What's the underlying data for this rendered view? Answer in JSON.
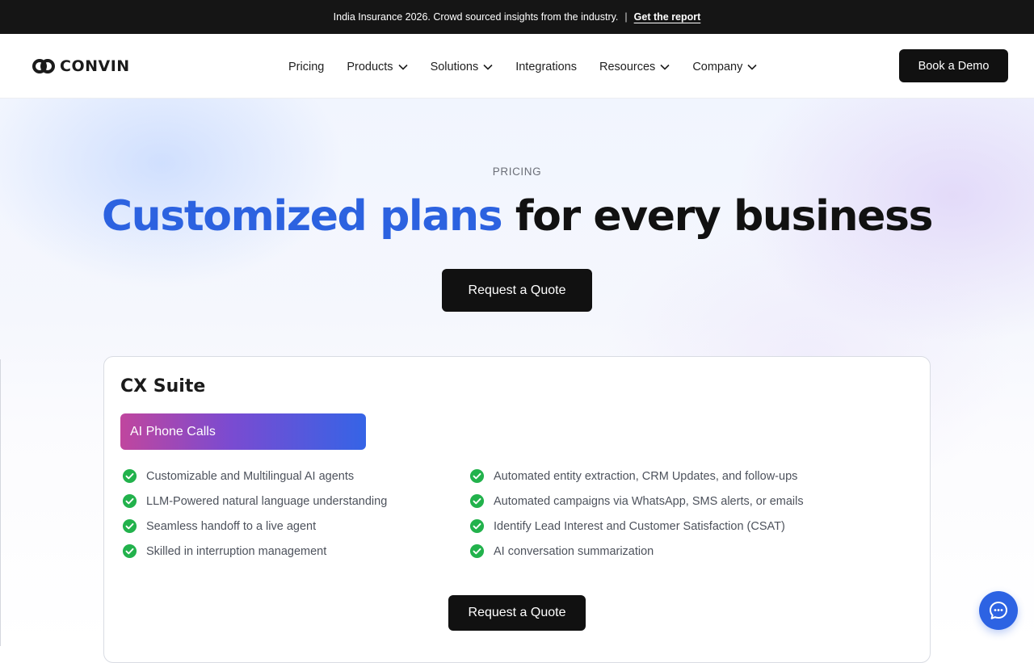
{
  "announcement": {
    "text": "India Insurance 2026. Crowd sourced insights from the industry.",
    "separator": "|",
    "link_label": "Get the report"
  },
  "header": {
    "logo_text": "CONVIN",
    "nav": [
      {
        "label": "Pricing",
        "has_dropdown": false
      },
      {
        "label": "Products",
        "has_dropdown": true
      },
      {
        "label": "Solutions",
        "has_dropdown": true
      },
      {
        "label": "Integrations",
        "has_dropdown": false
      },
      {
        "label": "Resources",
        "has_dropdown": true
      },
      {
        "label": "Company",
        "has_dropdown": true
      }
    ],
    "cta_label": "Book a Demo"
  },
  "hero": {
    "eyebrow": "PRICING",
    "headline_accent": "Customized plans",
    "headline_rest": " for every business",
    "cta_label": "Request a Quote"
  },
  "card": {
    "title": "CX Suite",
    "product_label": "AI Phone Calls",
    "features_left": [
      "Customizable and Multilingual AI agents",
      "LLM-Powered natural language understanding",
      "Seamless handoff to a live agent",
      "Skilled in interruption management"
    ],
    "features_right": [
      "Automated entity extraction, CRM Updates, and follow-ups",
      "Automated campaigns via WhatsApp, SMS alerts, or emails",
      "Identify Lead Interest and Customer Satisfaction (CSAT)",
      "AI conversation summarization"
    ],
    "cta_label": "Request a Quote"
  },
  "icons": {
    "logo": "convin-logo-icon",
    "dropdown": "chevron-down-icon",
    "feature": "check-circle-icon",
    "chat": "chat-bubble-icon"
  },
  "colors": {
    "accent_blue": "#2c62e0",
    "check_green": "#22b24c",
    "button_dark": "#111111",
    "pill_gradient": [
      "#c0469e",
      "#7a4bd1",
      "#3564e6"
    ]
  }
}
